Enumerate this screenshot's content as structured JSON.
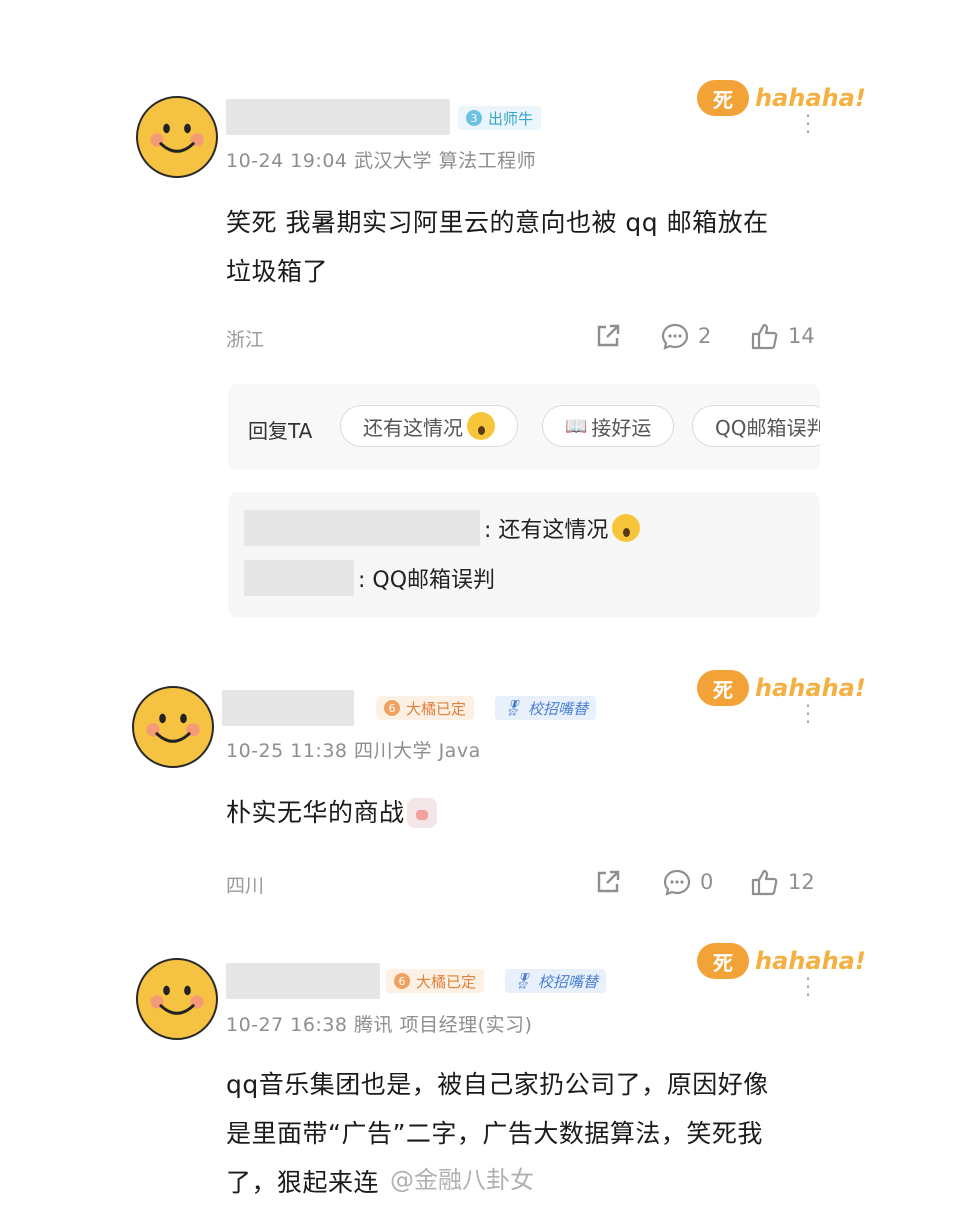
{
  "comments": [
    {
      "badges": [
        {
          "num": "3",
          "text": "出师牛"
        }
      ],
      "meta": "10-24 19:04  武汉大学 算法工程师",
      "content_lines": [
        "笑死 我暑期实习阿里云的意向也被 qq 邮箱放在",
        "垃圾箱了"
      ],
      "location": "浙江",
      "comment_count": "2",
      "like_count": "14",
      "sticker": {
        "glyph": "死",
        "text": "hahaha!"
      }
    },
    {
      "badges": [
        {
          "num": "6",
          "text": "大橘已定"
        },
        {
          "text": "校招嘴替"
        }
      ],
      "meta": "10-25 11:38  四川大学 Java",
      "content_lines": [
        "朴实无华的商战"
      ],
      "location": "四川",
      "comment_count": "0",
      "like_count": "12",
      "sticker": {
        "glyph": "死",
        "text": "hahaha!"
      }
    },
    {
      "badges": [
        {
          "num": "6",
          "text": "大橘已定"
        },
        {
          "text": "校招嘴替"
        }
      ],
      "meta": "10-27 16:38  腾讯 项目经理(实习)",
      "content_lines": [
        "qq音乐集团也是，被自己家扔公司了，原因好像",
        "是里面带“广告”二字，广告大数据算法，笑死我",
        "了，狠起来连"
      ],
      "sticker": {
        "glyph": "死",
        "text": "hahaha!"
      }
    }
  ],
  "reply_bar": {
    "label": "回复TA",
    "chips": [
      "还有这情况",
      "接好运",
      "QQ邮箱误判"
    ]
  },
  "sub_replies": [
    {
      "text": ": 还有这情况"
    },
    {
      "text": ": QQ邮箱误判"
    }
  ],
  "watermark": "@金融八卦女"
}
